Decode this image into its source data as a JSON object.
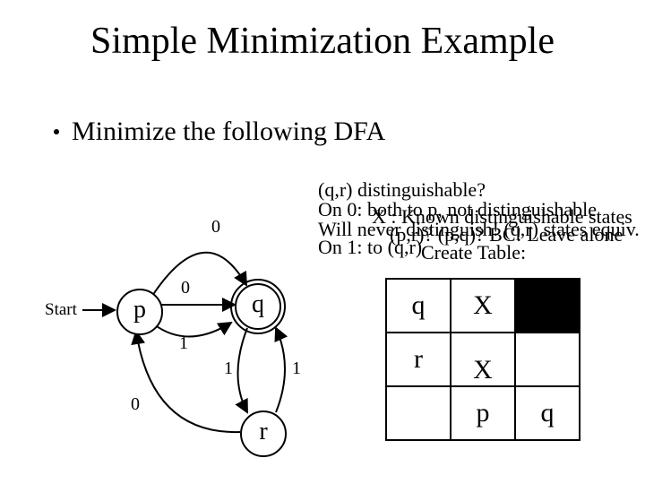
{
  "title": "Simple Minimization Example",
  "bullet": "Minimize the following DFA",
  "dfa": {
    "start_label": "Start",
    "states": {
      "p": "p",
      "q": "q",
      "r": "r"
    },
    "edge_labels": {
      "pq_top": "0",
      "pq_0": "0",
      "pq_1": "1",
      "qr_1l": "1",
      "qr_1r": "1",
      "rp_0": "0"
    }
  },
  "notes": {
    "l1": "(q,r) distinguishable?",
    "l2": "On 0: both to p, not distinguishable",
    "l2b": "X : Known distinguishable states",
    "l3": "Will never distinguish! (q,r) states equiv.",
    "l3b": "(p,r)? (p,q)? BC! Leave alone",
    "l4": "On 1: to (q,r)",
    "l4b": "Create Table:"
  },
  "table": {
    "r1c1": "q",
    "r1c2": "X",
    "r2c1": "r",
    "r2c2": "X",
    "r3c2": "p",
    "r3c3": "q"
  }
}
